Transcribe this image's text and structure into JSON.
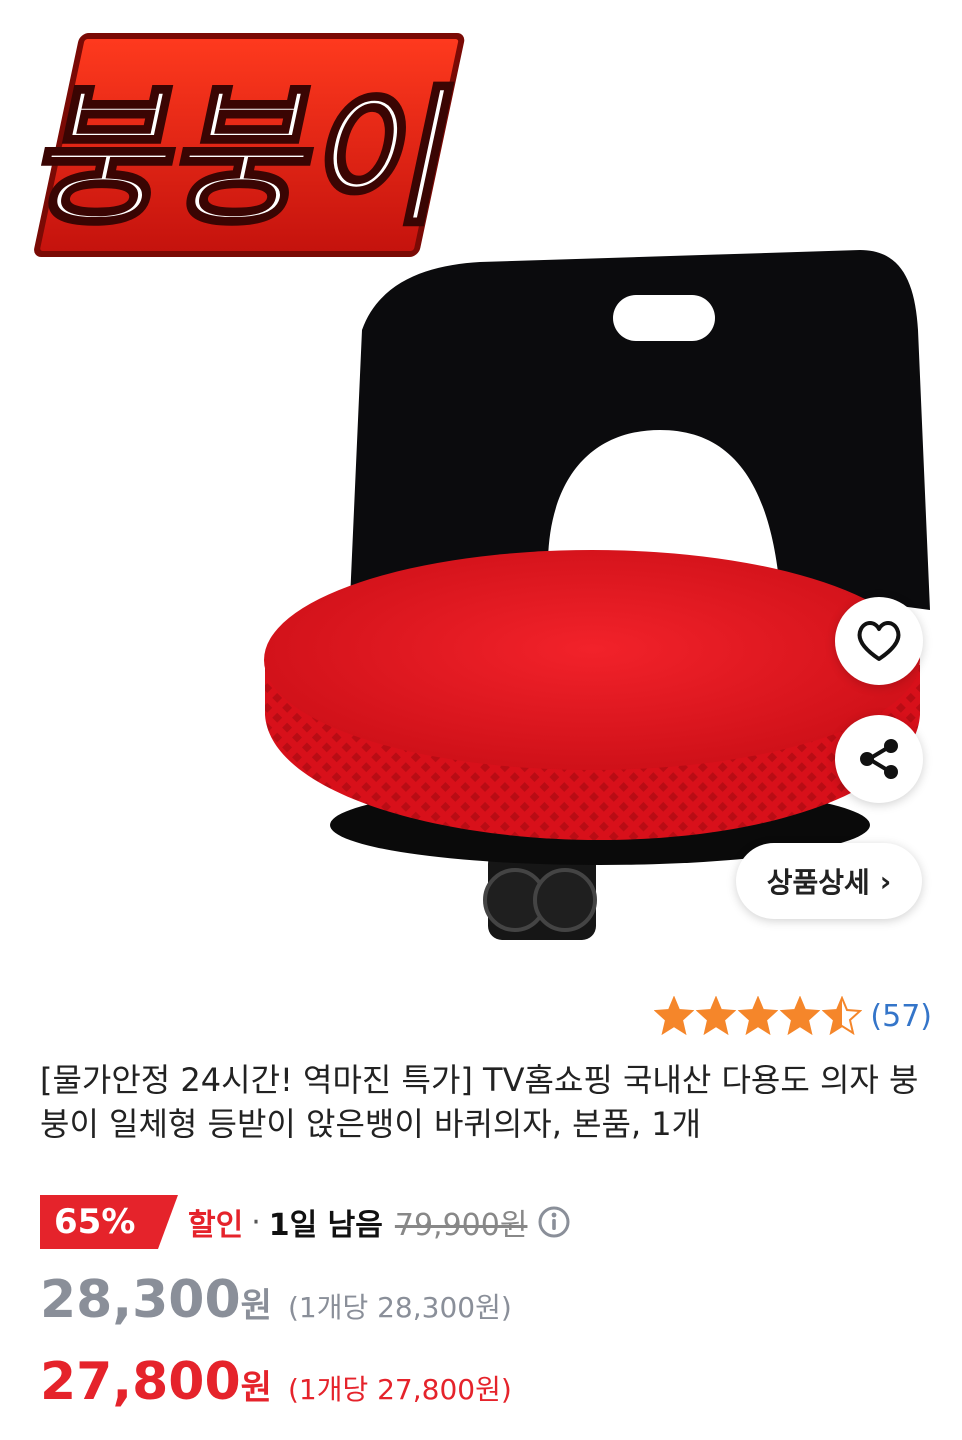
{
  "product": {
    "brand_logo_text": "붕붕이",
    "image_alt": "붕붕이 일체형 등받이 바퀴의자",
    "title": "[물가안정 24시간! 역마진 특가] TV홈쇼핑 국내산 다용도 의자 붕붕이 일체형 등받이 앉은뱅이 바퀴의자, 본품, 1개"
  },
  "actions": {
    "like_icon": "heart-outline-icon",
    "share_icon": "share-icon",
    "detail_label": "상품상세",
    "detail_chevron": "›"
  },
  "rating": {
    "stars": 4.5,
    "review_count": "(57)"
  },
  "pricing": {
    "discount_percent": "65%",
    "sale_label": "할인",
    "separator": "·",
    "days_left": "1일 남음",
    "original_price": "79,900원",
    "normal_price": "28,300",
    "normal_price_unit": "원",
    "normal_unit_price": "(1개당 28,300원)",
    "coupon_price": "27,800",
    "coupon_price_unit": "원",
    "coupon_unit_price": "(1개당 27,800원)"
  },
  "colors": {
    "accent_red": "#e5232b",
    "star_orange": "#f5862a",
    "link_blue": "#3475c9",
    "muted_gray": "#8a8f99"
  }
}
